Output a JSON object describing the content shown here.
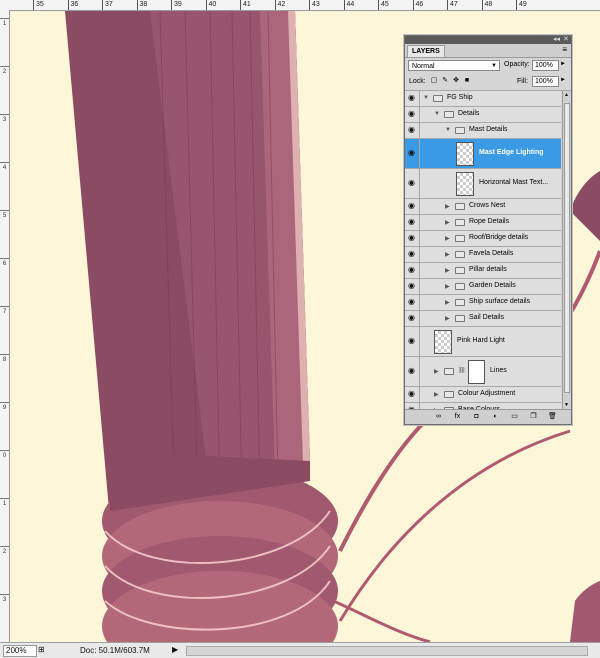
{
  "ruler": {
    "ticks": [
      "35",
      "36",
      "37",
      "38",
      "39",
      "40",
      "41",
      "42",
      "43",
      "44",
      "45",
      "46",
      "47",
      "48",
      "49"
    ],
    "left_labels": [
      "1",
      "2",
      "3",
      "4",
      "5",
      "6",
      "7",
      "8",
      "9",
      "0",
      "1",
      "2",
      "3"
    ]
  },
  "status": {
    "zoom": "200%",
    "doc": "Doc: 50.1M/603.7M"
  },
  "layers_panel": {
    "tab": "LAYERS",
    "blend_mode": "Normal",
    "opacity_label": "Opacity:",
    "opacity_value": "100%",
    "lock_label": "Lock:",
    "fill_label": "Fill:",
    "fill_value": "100%",
    "layers": [
      {
        "name": "FG Ship",
        "kind": "group",
        "depth": 0,
        "expanded": true
      },
      {
        "name": "Details",
        "kind": "group",
        "depth": 1,
        "expanded": true
      },
      {
        "name": "Mast Details",
        "kind": "group",
        "depth": 2,
        "expanded": true
      },
      {
        "name": "Mast Edge Lighting",
        "kind": "layer",
        "depth": 3,
        "selected": true
      },
      {
        "name": "Horizontal Mast Text...",
        "kind": "layer",
        "depth": 3
      },
      {
        "name": "Crows Nest",
        "kind": "group",
        "depth": 2
      },
      {
        "name": "Rope Details",
        "kind": "group",
        "depth": 2
      },
      {
        "name": "Roof/Bridge details",
        "kind": "group",
        "depth": 2
      },
      {
        "name": "Favela Details",
        "kind": "group",
        "depth": 2
      },
      {
        "name": "Pillar details",
        "kind": "group",
        "depth": 2
      },
      {
        "name": "Garden Details",
        "kind": "group",
        "depth": 2
      },
      {
        "name": "Ship surface details",
        "kind": "group",
        "depth": 2
      },
      {
        "name": "Sail Details",
        "kind": "group",
        "depth": 2
      },
      {
        "name": "Pink Hard Light",
        "kind": "layer",
        "depth": 1
      },
      {
        "name": "Lines",
        "kind": "masked-group",
        "depth": 1
      },
      {
        "name": "Colour Adjustment",
        "kind": "group",
        "depth": 1
      },
      {
        "name": "Base Colours",
        "kind": "group",
        "depth": 1
      }
    ],
    "bottom_icons": [
      "link-icon",
      "fx-icon",
      "mask-icon",
      "adjustment-icon",
      "group-icon",
      "new-layer-icon",
      "trash-icon"
    ]
  },
  "colors": {
    "canvas_bg": "#fdf6d8",
    "mast": "#8a4b63",
    "mast_light": "#b56d80",
    "rope": "#c87882",
    "selection": "#3a9ae6"
  }
}
